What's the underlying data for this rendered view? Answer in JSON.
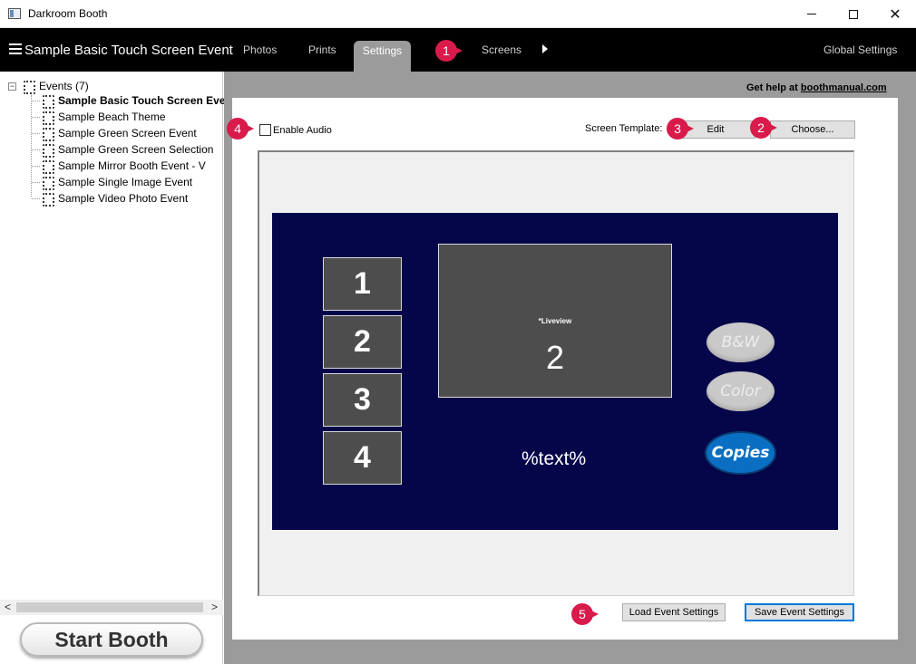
{
  "window": {
    "title": "Darkroom Booth"
  },
  "menubar": {
    "event_title": "Sample Basic Touch Screen Event",
    "tabs": [
      "Photos",
      "Prints",
      "Settings",
      "Screens"
    ],
    "active_tab": "Settings",
    "global_settings": "Global Settings"
  },
  "callouts": [
    "1",
    "2",
    "3",
    "4",
    "5"
  ],
  "tree": {
    "root_label": "Events (7)",
    "items": [
      {
        "label": "Sample Basic Touch Screen Event",
        "selected": true
      },
      {
        "label": "Sample Beach Theme",
        "selected": false
      },
      {
        "label": "Sample Green Screen Event",
        "selected": false
      },
      {
        "label": "Sample Green Screen Selection",
        "selected": false
      },
      {
        "label": "Sample Mirror Booth Event - V",
        "selected": false
      },
      {
        "label": "Sample Single Image Event",
        "selected": false
      },
      {
        "label": "Sample Video Photo Event",
        "selected": false
      }
    ]
  },
  "start_booth": "Start Booth",
  "help": {
    "prefix": "Get help at ",
    "link": "boothmanual.com"
  },
  "settings": {
    "enable_audio_label": "Enable Audio",
    "enable_audio_checked": false,
    "screen_template_label": "Screen Template:",
    "edit_button": "Edit",
    "choose_button": "Choose...",
    "load_button": "Load Event Settings",
    "save_button": "Save Event Settings"
  },
  "preview": {
    "canvas_color": "#05054a",
    "slots": [
      "1",
      "2",
      "3",
      "4"
    ],
    "liveview_label": "*Liveview",
    "countdown": "2",
    "text_placeholder": "%text%",
    "buttons": {
      "bw": "B&W",
      "color": "Color",
      "copies": "Copies"
    }
  },
  "colors": {
    "accent_marker": "#d81b4b",
    "copies_button": "#0a6fc2",
    "menubar_bg": "#000000",
    "main_bg": "#9b9b9b"
  }
}
